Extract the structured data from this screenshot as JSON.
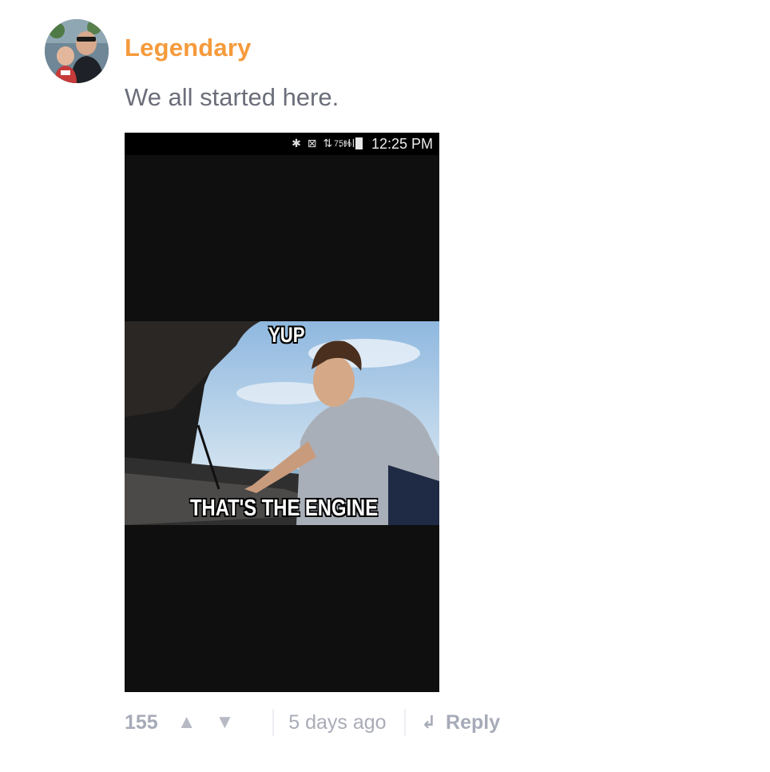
{
  "comment": {
    "author": "Legendary",
    "text": "We all started here.",
    "accent_color": "#f59a3b"
  },
  "media": {
    "status_bar": {
      "icons": "✱ ⊠ ⇅ .ıll",
      "battery_percent": "75%",
      "time": "12:25 PM"
    },
    "meme": {
      "top_text": "YUP",
      "bottom_text": "THAT'S THE ENGINE"
    }
  },
  "footer": {
    "vote_count": "155",
    "upvote_icon": "▲",
    "downvote_icon": "▼",
    "timestamp": "5 days ago",
    "reply_icon": "↲",
    "reply_label": "Reply"
  }
}
